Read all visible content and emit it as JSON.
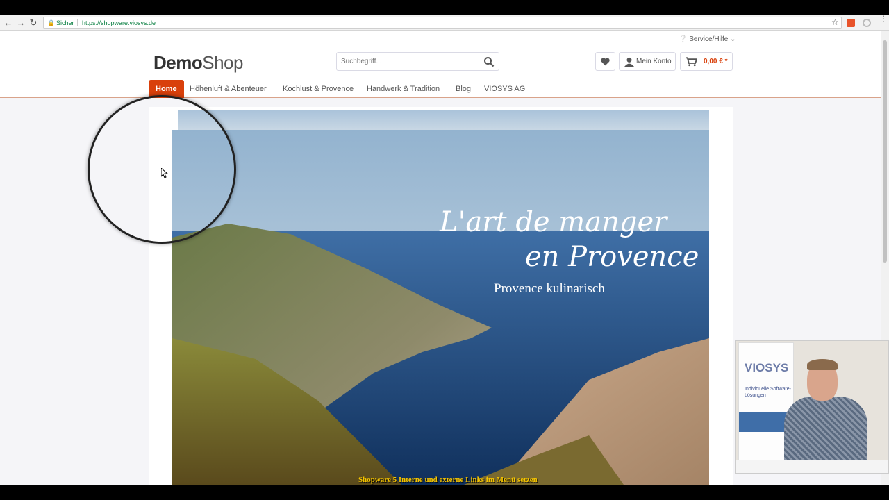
{
  "browser": {
    "secure_label": "Sicher",
    "url": "https://shopware.viosys.de"
  },
  "header": {
    "service_label": "Service/Hilfe",
    "logo_bold": "Demo",
    "logo_light": "Shop",
    "search_placeholder": "Suchbegriff...",
    "account_label": "Mein Konto",
    "cart_total": "0,00 € *"
  },
  "nav": {
    "items": [
      "Home",
      "Höhenluft & Abenteuer",
      "Kochlust & Provence",
      "Handwerk & Tradition",
      "Blog",
      "VIOSYS AG"
    ],
    "active_index": 0
  },
  "banner": {
    "headline_line1": "L'art de manger",
    "headline_line2": "en Provence",
    "subheadline": "Provence kulinarisch"
  },
  "video": {
    "caption": "Shopware 5 Interne und externe Links im Menü setzen",
    "rollup_logo": "VIOSYS",
    "rollup_text": "Individuelle Software-Lösungen"
  },
  "colors": {
    "accent": "#d9400b",
    "caption": "#f5c400",
    "secure": "#0b8043"
  }
}
